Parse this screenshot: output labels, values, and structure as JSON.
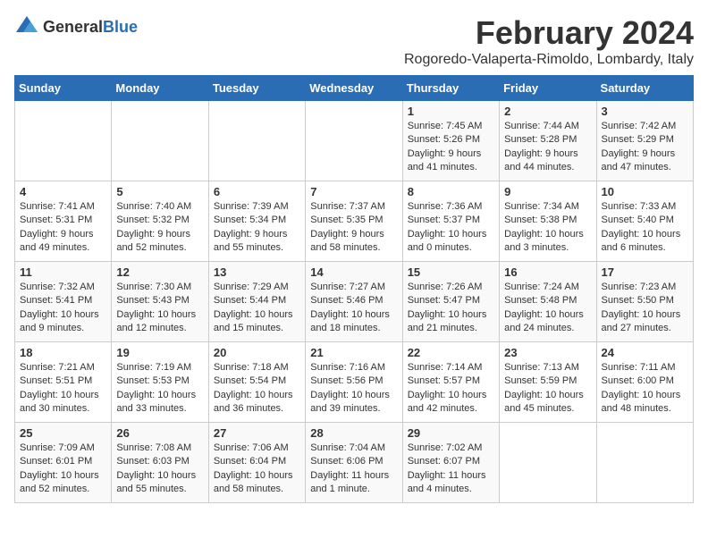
{
  "logo": {
    "general": "General",
    "blue": "Blue"
  },
  "title": "February 2024",
  "subtitle": "Rogoredo-Valaperta-Rimoldo, Lombardy, Italy",
  "days_of_week": [
    "Sunday",
    "Monday",
    "Tuesday",
    "Wednesday",
    "Thursday",
    "Friday",
    "Saturday"
  ],
  "weeks": [
    [
      {
        "day": "",
        "content": ""
      },
      {
        "day": "",
        "content": ""
      },
      {
        "day": "",
        "content": ""
      },
      {
        "day": "",
        "content": ""
      },
      {
        "day": "1",
        "content": "Sunrise: 7:45 AM\nSunset: 5:26 PM\nDaylight: 9 hours\nand 41 minutes."
      },
      {
        "day": "2",
        "content": "Sunrise: 7:44 AM\nSunset: 5:28 PM\nDaylight: 9 hours\nand 44 minutes."
      },
      {
        "day": "3",
        "content": "Sunrise: 7:42 AM\nSunset: 5:29 PM\nDaylight: 9 hours\nand 47 minutes."
      }
    ],
    [
      {
        "day": "4",
        "content": "Sunrise: 7:41 AM\nSunset: 5:31 PM\nDaylight: 9 hours\nand 49 minutes."
      },
      {
        "day": "5",
        "content": "Sunrise: 7:40 AM\nSunset: 5:32 PM\nDaylight: 9 hours\nand 52 minutes."
      },
      {
        "day": "6",
        "content": "Sunrise: 7:39 AM\nSunset: 5:34 PM\nDaylight: 9 hours\nand 55 minutes."
      },
      {
        "day": "7",
        "content": "Sunrise: 7:37 AM\nSunset: 5:35 PM\nDaylight: 9 hours\nand 58 minutes."
      },
      {
        "day": "8",
        "content": "Sunrise: 7:36 AM\nSunset: 5:37 PM\nDaylight: 10 hours\nand 0 minutes."
      },
      {
        "day": "9",
        "content": "Sunrise: 7:34 AM\nSunset: 5:38 PM\nDaylight: 10 hours\nand 3 minutes."
      },
      {
        "day": "10",
        "content": "Sunrise: 7:33 AM\nSunset: 5:40 PM\nDaylight: 10 hours\nand 6 minutes."
      }
    ],
    [
      {
        "day": "11",
        "content": "Sunrise: 7:32 AM\nSunset: 5:41 PM\nDaylight: 10 hours\nand 9 minutes."
      },
      {
        "day": "12",
        "content": "Sunrise: 7:30 AM\nSunset: 5:43 PM\nDaylight: 10 hours\nand 12 minutes."
      },
      {
        "day": "13",
        "content": "Sunrise: 7:29 AM\nSunset: 5:44 PM\nDaylight: 10 hours\nand 15 minutes."
      },
      {
        "day": "14",
        "content": "Sunrise: 7:27 AM\nSunset: 5:46 PM\nDaylight: 10 hours\nand 18 minutes."
      },
      {
        "day": "15",
        "content": "Sunrise: 7:26 AM\nSunset: 5:47 PM\nDaylight: 10 hours\nand 21 minutes."
      },
      {
        "day": "16",
        "content": "Sunrise: 7:24 AM\nSunset: 5:48 PM\nDaylight: 10 hours\nand 24 minutes."
      },
      {
        "day": "17",
        "content": "Sunrise: 7:23 AM\nSunset: 5:50 PM\nDaylight: 10 hours\nand 27 minutes."
      }
    ],
    [
      {
        "day": "18",
        "content": "Sunrise: 7:21 AM\nSunset: 5:51 PM\nDaylight: 10 hours\nand 30 minutes."
      },
      {
        "day": "19",
        "content": "Sunrise: 7:19 AM\nSunset: 5:53 PM\nDaylight: 10 hours\nand 33 minutes."
      },
      {
        "day": "20",
        "content": "Sunrise: 7:18 AM\nSunset: 5:54 PM\nDaylight: 10 hours\nand 36 minutes."
      },
      {
        "day": "21",
        "content": "Sunrise: 7:16 AM\nSunset: 5:56 PM\nDaylight: 10 hours\nand 39 minutes."
      },
      {
        "day": "22",
        "content": "Sunrise: 7:14 AM\nSunset: 5:57 PM\nDaylight: 10 hours\nand 42 minutes."
      },
      {
        "day": "23",
        "content": "Sunrise: 7:13 AM\nSunset: 5:59 PM\nDaylight: 10 hours\nand 45 minutes."
      },
      {
        "day": "24",
        "content": "Sunrise: 7:11 AM\nSunset: 6:00 PM\nDaylight: 10 hours\nand 48 minutes."
      }
    ],
    [
      {
        "day": "25",
        "content": "Sunrise: 7:09 AM\nSunset: 6:01 PM\nDaylight: 10 hours\nand 52 minutes."
      },
      {
        "day": "26",
        "content": "Sunrise: 7:08 AM\nSunset: 6:03 PM\nDaylight: 10 hours\nand 55 minutes."
      },
      {
        "day": "27",
        "content": "Sunrise: 7:06 AM\nSunset: 6:04 PM\nDaylight: 10 hours\nand 58 minutes."
      },
      {
        "day": "28",
        "content": "Sunrise: 7:04 AM\nSunset: 6:06 PM\nDaylight: 11 hours\nand 1 minute."
      },
      {
        "day": "29",
        "content": "Sunrise: 7:02 AM\nSunset: 6:07 PM\nDaylight: 11 hours\nand 4 minutes."
      },
      {
        "day": "",
        "content": ""
      },
      {
        "day": "",
        "content": ""
      }
    ]
  ]
}
